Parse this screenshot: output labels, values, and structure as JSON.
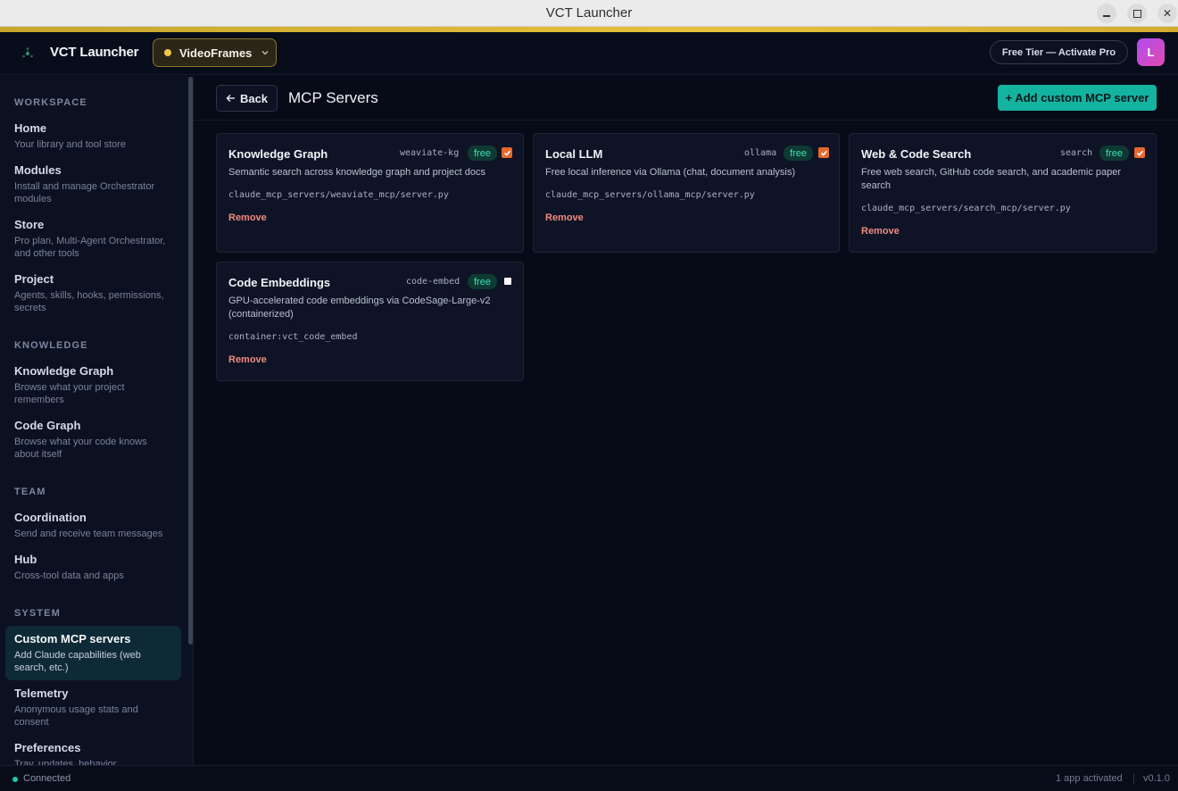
{
  "window": {
    "title": "VCT Launcher"
  },
  "header": {
    "app_name": "VCT Launcher",
    "project": "VideoFrames",
    "tier": "Free Tier — Activate Pro",
    "avatar_initial": "L",
    "accent_color": "#e6c23d"
  },
  "sidebar": {
    "sections": {
      "workspace": "WORKSPACE",
      "knowledge": "KNOWLEDGE",
      "team": "TEAM",
      "system": "SYSTEM"
    },
    "items": [
      {
        "label": "Home",
        "desc": "Your library and tool store"
      },
      {
        "label": "Modules",
        "desc": "Install and manage Orchestrator modules"
      },
      {
        "label": "Store",
        "desc": "Pro plan, Multi-Agent Orchestrator, and other tools"
      },
      {
        "label": "Project",
        "desc": "Agents, skills, hooks, permissions, secrets"
      },
      {
        "label": "Knowledge Graph",
        "desc": "Browse what your project remembers"
      },
      {
        "label": "Code Graph",
        "desc": "Browse what your code knows about itself"
      },
      {
        "label": "Coordination",
        "desc": "Send and receive team messages"
      },
      {
        "label": "Hub",
        "desc": "Cross-tool data and apps"
      },
      {
        "label": "Custom MCP servers",
        "desc": "Add Claude capabilities (web search, etc.)"
      },
      {
        "label": "Telemetry",
        "desc": "Anonymous usage stats and consent"
      },
      {
        "label": "Preferences",
        "desc": "Tray, updates, behavior"
      }
    ],
    "active_color": "#0e2a36"
  },
  "main": {
    "back_label": "Back",
    "title": "MCP Servers",
    "add_label": "+ Add custom MCP server",
    "add_color": "#13b3a0",
    "servers": [
      {
        "name": "Knowledge Graph",
        "id": "weaviate-kg",
        "badge": "free",
        "enabled": true,
        "desc": "Semantic search across knowledge graph and project docs",
        "path": "claude_mcp_servers/weaviate_mcp/server.py",
        "remove": "Remove"
      },
      {
        "name": "Local LLM",
        "id": "ollama",
        "badge": "free",
        "enabled": true,
        "desc": "Free local inference via Ollama (chat, document analysis)",
        "path": "claude_mcp_servers/ollama_mcp/server.py",
        "remove": "Remove"
      },
      {
        "name": "Web & Code Search",
        "id": "search",
        "badge": "free",
        "enabled": true,
        "desc": "Free web search, GitHub code search, and academic paper search",
        "path": "claude_mcp_servers/search_mcp/server.py",
        "remove": "Remove"
      },
      {
        "name": "Code Embeddings",
        "id": "code-embed",
        "badge": "free",
        "enabled": false,
        "desc": "GPU-accelerated code embeddings via CodeSage-Large-v2 (containerized)",
        "path": "container:vct_code_embed",
        "remove": "Remove"
      }
    ]
  },
  "status": {
    "connection": "Connected",
    "apps": "1 app activated",
    "version": "v0.1.0"
  }
}
